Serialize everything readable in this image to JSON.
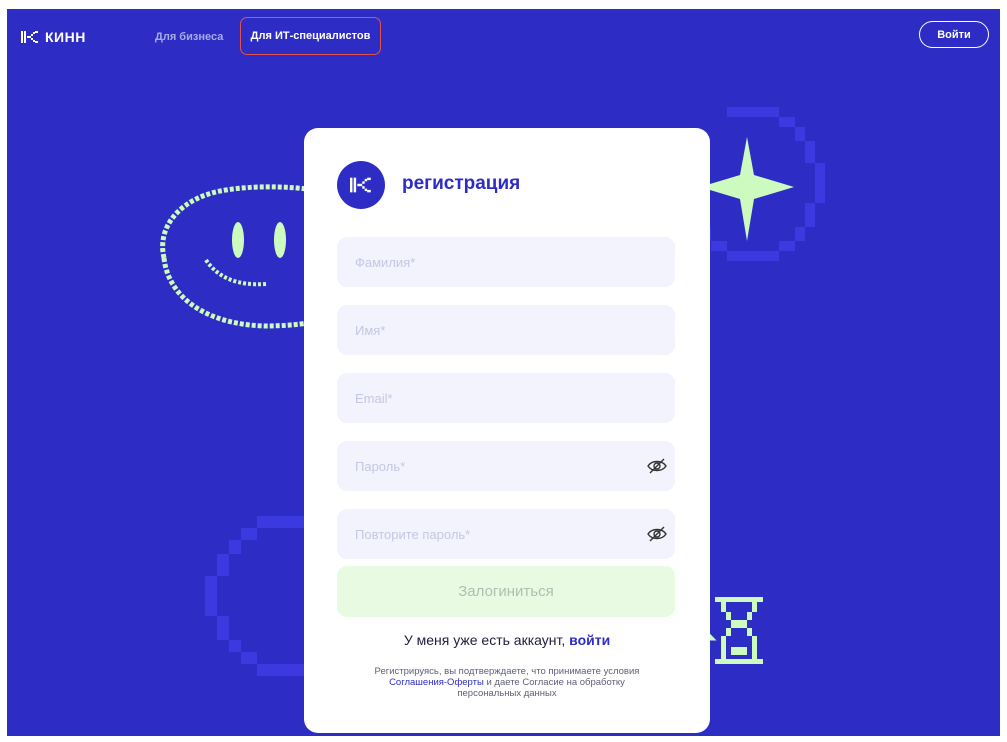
{
  "header": {
    "logo_text": "КИНН",
    "nav": {
      "business": "Для бизнеса",
      "it_specialists": "Для ИТ-специалистов"
    },
    "login_button": "Войти"
  },
  "form": {
    "title": "регистрация",
    "fields": {
      "last_name": {
        "placeholder": "Фамилия*",
        "value": ""
      },
      "first_name": {
        "placeholder": "Имя*",
        "value": ""
      },
      "email": {
        "placeholder": "Email*",
        "value": ""
      },
      "password": {
        "placeholder": "Пароль*",
        "value": ""
      },
      "password_repeat": {
        "placeholder": "Повторите пароль*",
        "value": ""
      }
    },
    "submit_label": "Залогиниться",
    "have_account_text": "У меня уже есть аккаунт, ",
    "have_account_link": "войти",
    "legal": {
      "before": "Регистрируясь, вы подтверждаете, что принимаете условия ",
      "link": "Соглашения-Оферты",
      "after": " и даете Согласие на обработку персональных данных"
    }
  },
  "icons": {
    "logo": "kinn-logo-icon",
    "eye_password": "eye-off-icon",
    "eye_repeat": "eye-off-icon"
  },
  "colors": {
    "background": "#2d2dc5",
    "accent_green": "#cdfbbf",
    "card": "#ffffff",
    "field_bg": "#f3f3fd",
    "submit_bg": "#e8fbe2",
    "highlight_border": "#e4504a"
  }
}
